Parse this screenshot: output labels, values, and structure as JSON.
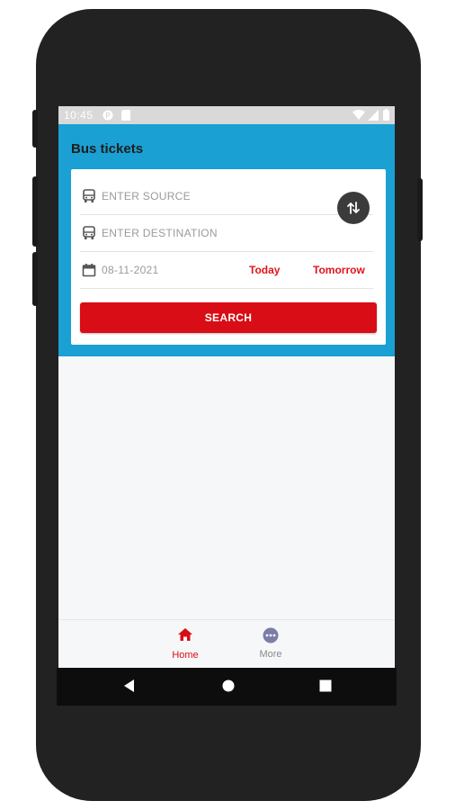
{
  "status_bar": {
    "time": "10:45"
  },
  "header": {
    "title": "Bus tickets"
  },
  "form": {
    "source_placeholder": "ENTER SOURCE",
    "destination_placeholder": "ENTER DESTINATION",
    "date_value": "08-11-2021",
    "today_label": "Today",
    "tomorrow_label": "Tomorrow",
    "search_label": "SEARCH"
  },
  "bottom_nav": {
    "items": [
      {
        "label": "Home",
        "icon": "home-icon",
        "active": true
      },
      {
        "label": "More",
        "icon": "more-icon",
        "active": false
      }
    ]
  },
  "colors": {
    "header_bg": "#1aa0d3",
    "accent_red": "#d80d15",
    "swap_bg": "#3b3b3b",
    "more_icon": "#7b7ea6"
  }
}
